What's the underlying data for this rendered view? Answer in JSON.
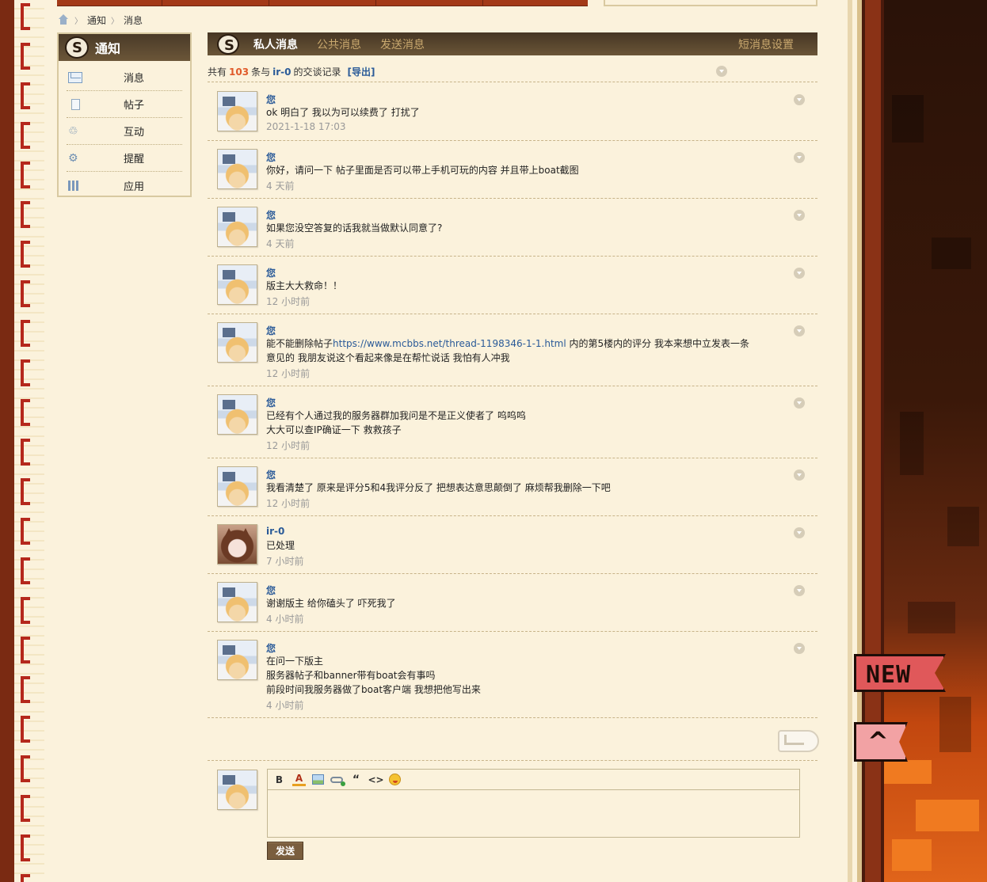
{
  "breadcrumb": {
    "items": [
      "通知",
      "消息"
    ]
  },
  "sidebar": {
    "title": "通知",
    "items": [
      {
        "label": "消息",
        "icon": "mail-icon"
      },
      {
        "label": "帖子",
        "icon": "document-icon"
      },
      {
        "label": "互动",
        "icon": "recycle-icon"
      },
      {
        "label": "提醒",
        "icon": "bell-gear-icon"
      },
      {
        "label": "应用",
        "icon": "grid-icon"
      }
    ]
  },
  "tabs": {
    "private": "私人消息",
    "public": "公共消息",
    "send": "发送消息",
    "settings": "短消息设置"
  },
  "summary": {
    "prefix": "共有",
    "count": "103",
    "mid": "条与",
    "peer": "ir-0",
    "suffix": "的交谈记录",
    "export": "[导出]"
  },
  "messages": [
    {
      "author": "您",
      "lines": [
        "ok 明白了 我以为可以续费了 打扰了"
      ],
      "time": "2021-1-18 17:03",
      "avatar": "me"
    },
    {
      "author": "您",
      "lines": [
        "你好，请问一下 帖子里面是否可以带上手机可玩的内容 并且带上boat截图"
      ],
      "time": "4 天前",
      "avatar": "me"
    },
    {
      "author": "您",
      "lines": [
        "如果您没空答复的话我就当做默认同意了?"
      ],
      "time": "4 天前",
      "avatar": "me"
    },
    {
      "author": "您",
      "lines": [
        "版主大大救命！！"
      ],
      "time": "12 小时前",
      "avatar": "me"
    },
    {
      "author": "您",
      "line1_pre": "能不能删除帖子",
      "line1_link": "https://www.mcbbs.net/thread-1198346-1-1.html",
      "line1_post": " 内的第5楼内的评分  我本来想中立发表一条",
      "lines": [
        "意见的 我朋友说这个看起来像是在帮忙说话  我怕有人冲我"
      ],
      "time": "12 小时前",
      "avatar": "me"
    },
    {
      "author": "您",
      "lines": [
        "已经有个人通过我的服务器群加我问是不是正义使者了 呜呜呜",
        "大大可以查IP确证一下 救救孩子"
      ],
      "time": "12 小时前",
      "avatar": "me"
    },
    {
      "author": "您",
      "lines": [
        "我看清楚了 原来是评分5和4我评分反了 把想表达意思颠倒了 麻烦帮我删除一下吧"
      ],
      "time": "12 小时前",
      "avatar": "me"
    },
    {
      "author": "ir-0",
      "lines": [
        "已处理"
      ],
      "time": "7 小时前",
      "avatar": "ir"
    },
    {
      "author": "您",
      "lines": [
        "谢谢版主 给你磕头了 吓死我了"
      ],
      "time": "4 小时前",
      "avatar": "me"
    },
    {
      "author": "您",
      "lines": [
        "在问一下版主",
        "服务器帖子和banner带有boat会有事吗",
        "前段时间我服务器做了boat客户端 我想把他写出来"
      ],
      "time": "4 小时前",
      "avatar": "me"
    }
  ],
  "editor": {
    "toolbar": [
      "bold-icon",
      "font-color-icon",
      "image-icon",
      "link-icon",
      "quote-icon",
      "code-icon",
      "smiley-icon"
    ],
    "bold_label": "B",
    "color_label": "A",
    "quote_label": "“",
    "code_label": "<>",
    "send_label": "发送"
  },
  "decor": {
    "new_flag": "NEW",
    "top_flag": "^"
  },
  "colors": {
    "accent_link": "#2a5a98",
    "count": "#e05a2a",
    "header_bg": "#4a3a28",
    "page_bg": "#fbf2dc"
  }
}
